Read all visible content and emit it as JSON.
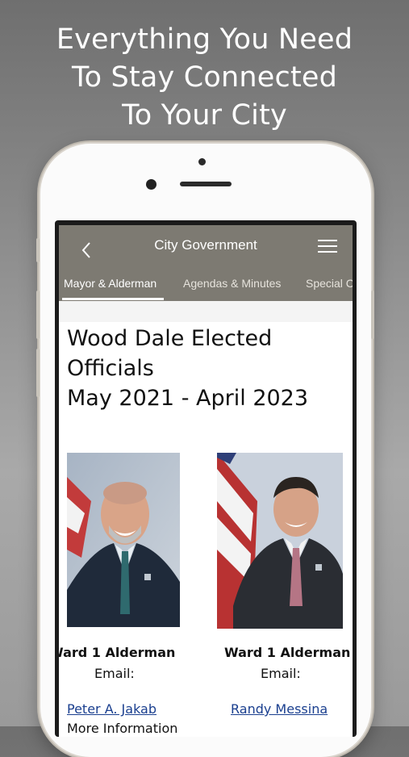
{
  "headline": {
    "line1": "Everything You Need",
    "line2": "To Stay Connected",
    "line3": "To Your City"
  },
  "app": {
    "nav_title": "City Government",
    "back_icon": "chevron-left-icon",
    "menu_icon": "hamburger-menu-icon",
    "nav_color": "#7d7a72",
    "tabs": [
      {
        "label": "Mayor & Alderman",
        "active": true
      },
      {
        "label": "Agendas & Minutes",
        "active": false
      },
      {
        "label": "Special C",
        "active": false
      }
    ]
  },
  "page": {
    "title_line1": "Wood Dale Elected",
    "title_line2": "Officials",
    "title_line3": "May 2021 - April 2023",
    "officials": [
      {
        "role": "Ward 1 Alderman",
        "email_label": "Email:",
        "name": "Peter A. Jakab"
      },
      {
        "role": "Ward 1 Alderman",
        "email_label": "Email:",
        "name": "Randy Messina"
      }
    ],
    "partial_text": "More Information"
  },
  "colors": {
    "link": "#1a3f8f",
    "page_background": "#ffffff"
  }
}
